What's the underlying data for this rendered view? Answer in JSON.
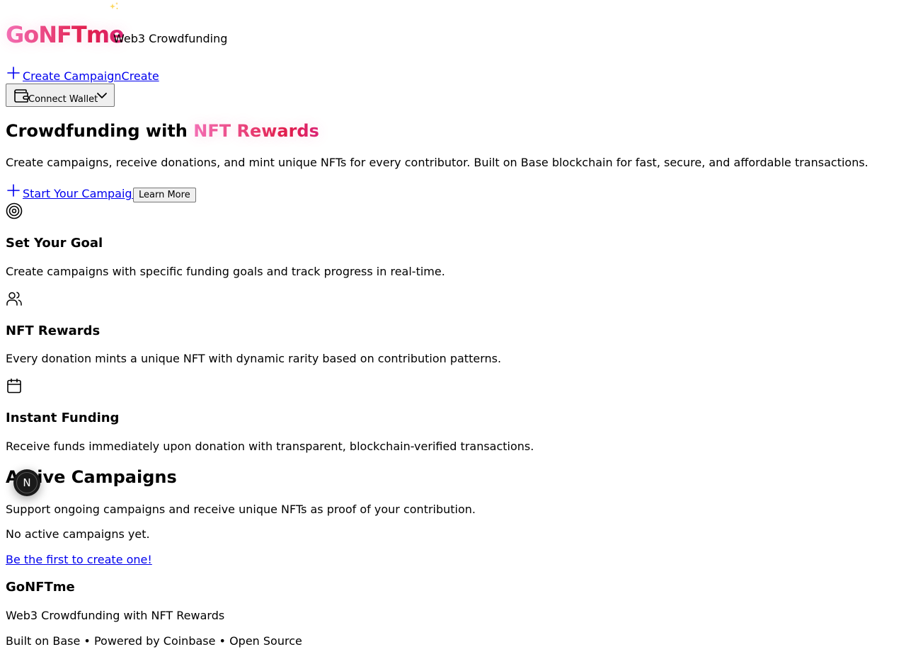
{
  "header": {
    "logo": "GoNFTme",
    "tagline": "Web3 Crowdfunding",
    "nav": {
      "create_campaign_label": "Create Campaign",
      "create_short_label": "Create"
    },
    "wallet": {
      "label": "Connect Wallet"
    }
  },
  "hero": {
    "title_prefix": "Crowdfunding with ",
    "title_accent": "NFT Rewards",
    "subtitle": "Create campaigns, receive donations, and mint unique NFTs for every contributor. Built on Base blockchain for fast, secure, and affordable transactions.",
    "primary_cta": "Start Your Campaign",
    "secondary_cta": "Learn More"
  },
  "features": [
    {
      "icon": "target-icon",
      "title": "Set Your Goal",
      "description": "Create campaigns with specific funding goals and track progress in real-time."
    },
    {
      "icon": "users-icon",
      "title": "NFT Rewards",
      "description": "Every donation mints a unique NFT with dynamic rarity based on contribution patterns."
    },
    {
      "icon": "calendar-icon",
      "title": "Instant Funding",
      "description": "Receive funds immediately upon donation with transparent, blockchain-verified transactions."
    }
  ],
  "campaigns": {
    "title": "Active Campaigns",
    "subtitle": "Support ongoing campaigns and receive unique NFTs as proof of your contribution.",
    "empty_text": "No active campaigns yet.",
    "empty_link": "Be the first to create one!"
  },
  "footer": {
    "brand": "GoNFTme",
    "tagline": "Web3 Crowdfunding with NFT Rewards",
    "credits": "Built on Base • Powered by Coinbase • Open Source"
  },
  "dev_badge": {
    "letter": "N"
  },
  "colors": {
    "accent_start": "#f472b6",
    "accent_end": "#e11d48",
    "link": "#0000ee",
    "sparkle": "#fbbf24"
  }
}
